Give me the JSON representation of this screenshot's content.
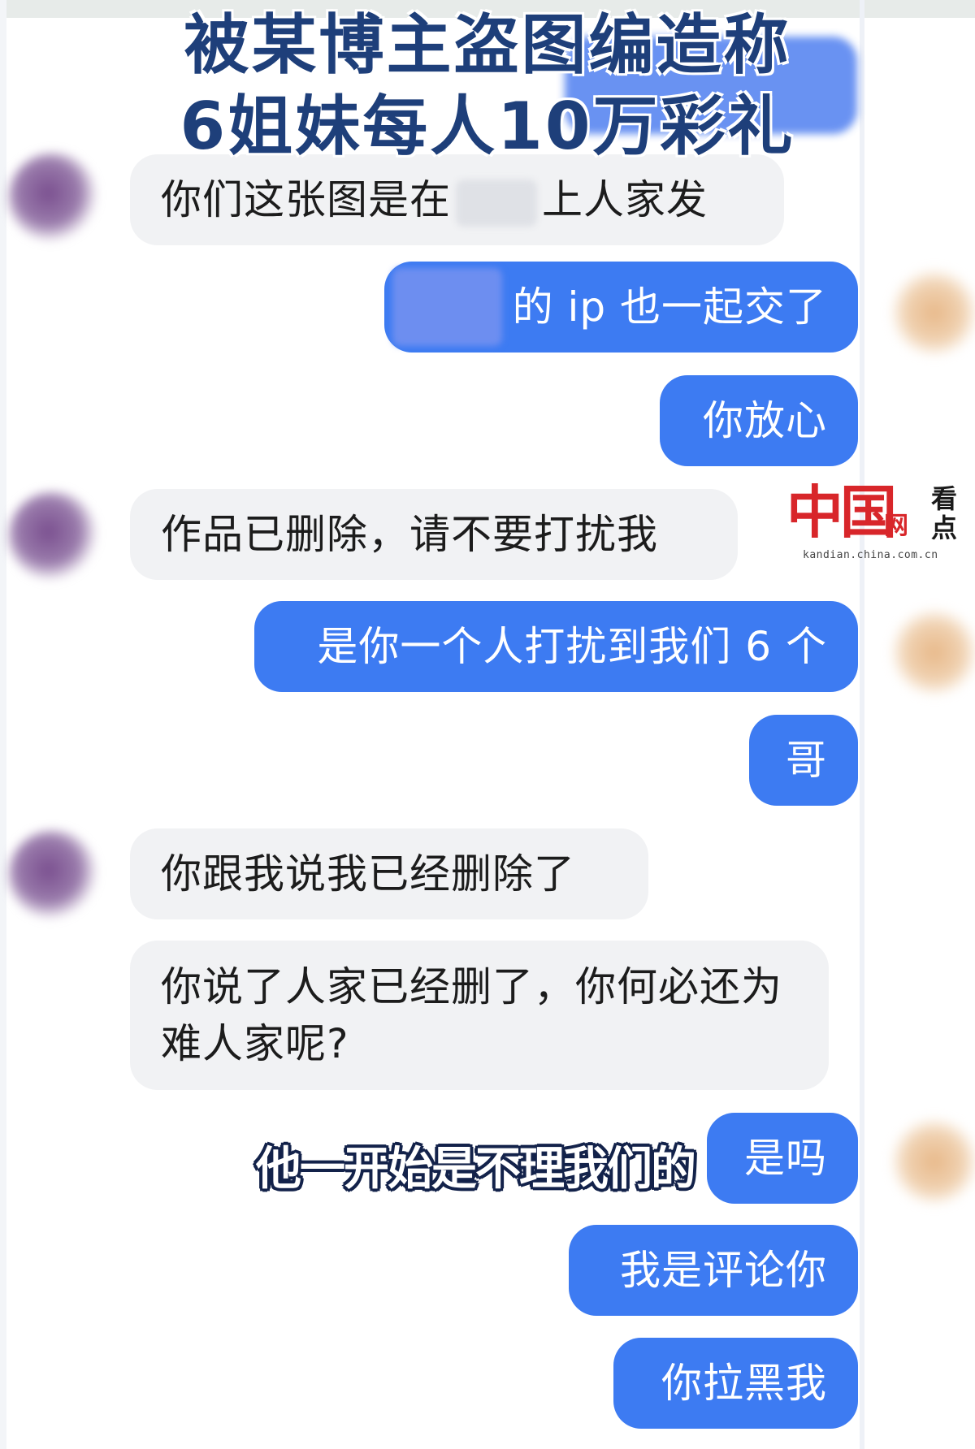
{
  "overlay": {
    "title_line1": "被某博主盗图编造称",
    "title_line2": "6姐妹每人10万彩礼",
    "subtitle": "他一开始是不理我们的"
  },
  "watermark": {
    "logo": "中国",
    "net": "网",
    "kandian": "看点",
    "url": "kandian.china.com.cn"
  },
  "messages": [
    {
      "side": "in",
      "text_before": "你们这张图是在",
      "text_after": "上人家发"
    },
    {
      "side": "out",
      "text": "的 ip 也一起交了"
    },
    {
      "side": "out",
      "text": "你放心"
    },
    {
      "side": "in",
      "text": "作品已删除，请不要打扰我"
    },
    {
      "side": "out",
      "text": "是你一个人打扰到我们 6 个"
    },
    {
      "side": "out",
      "text": "哥"
    },
    {
      "side": "in",
      "text": "你跟我说我已经删除了"
    },
    {
      "side": "in",
      "text": "你说了人家已经删了，你何必还为难人家呢?"
    },
    {
      "side": "out",
      "text": "是吗"
    },
    {
      "side": "out",
      "text": "我是评论你"
    },
    {
      "side": "out",
      "text": "你拉黑我"
    }
  ],
  "colors": {
    "outgoing_bubble": "#3d7bf2",
    "incoming_bubble": "#f1f2f4",
    "title": "#1e3f7a",
    "watermark_red": "#d8262a"
  }
}
